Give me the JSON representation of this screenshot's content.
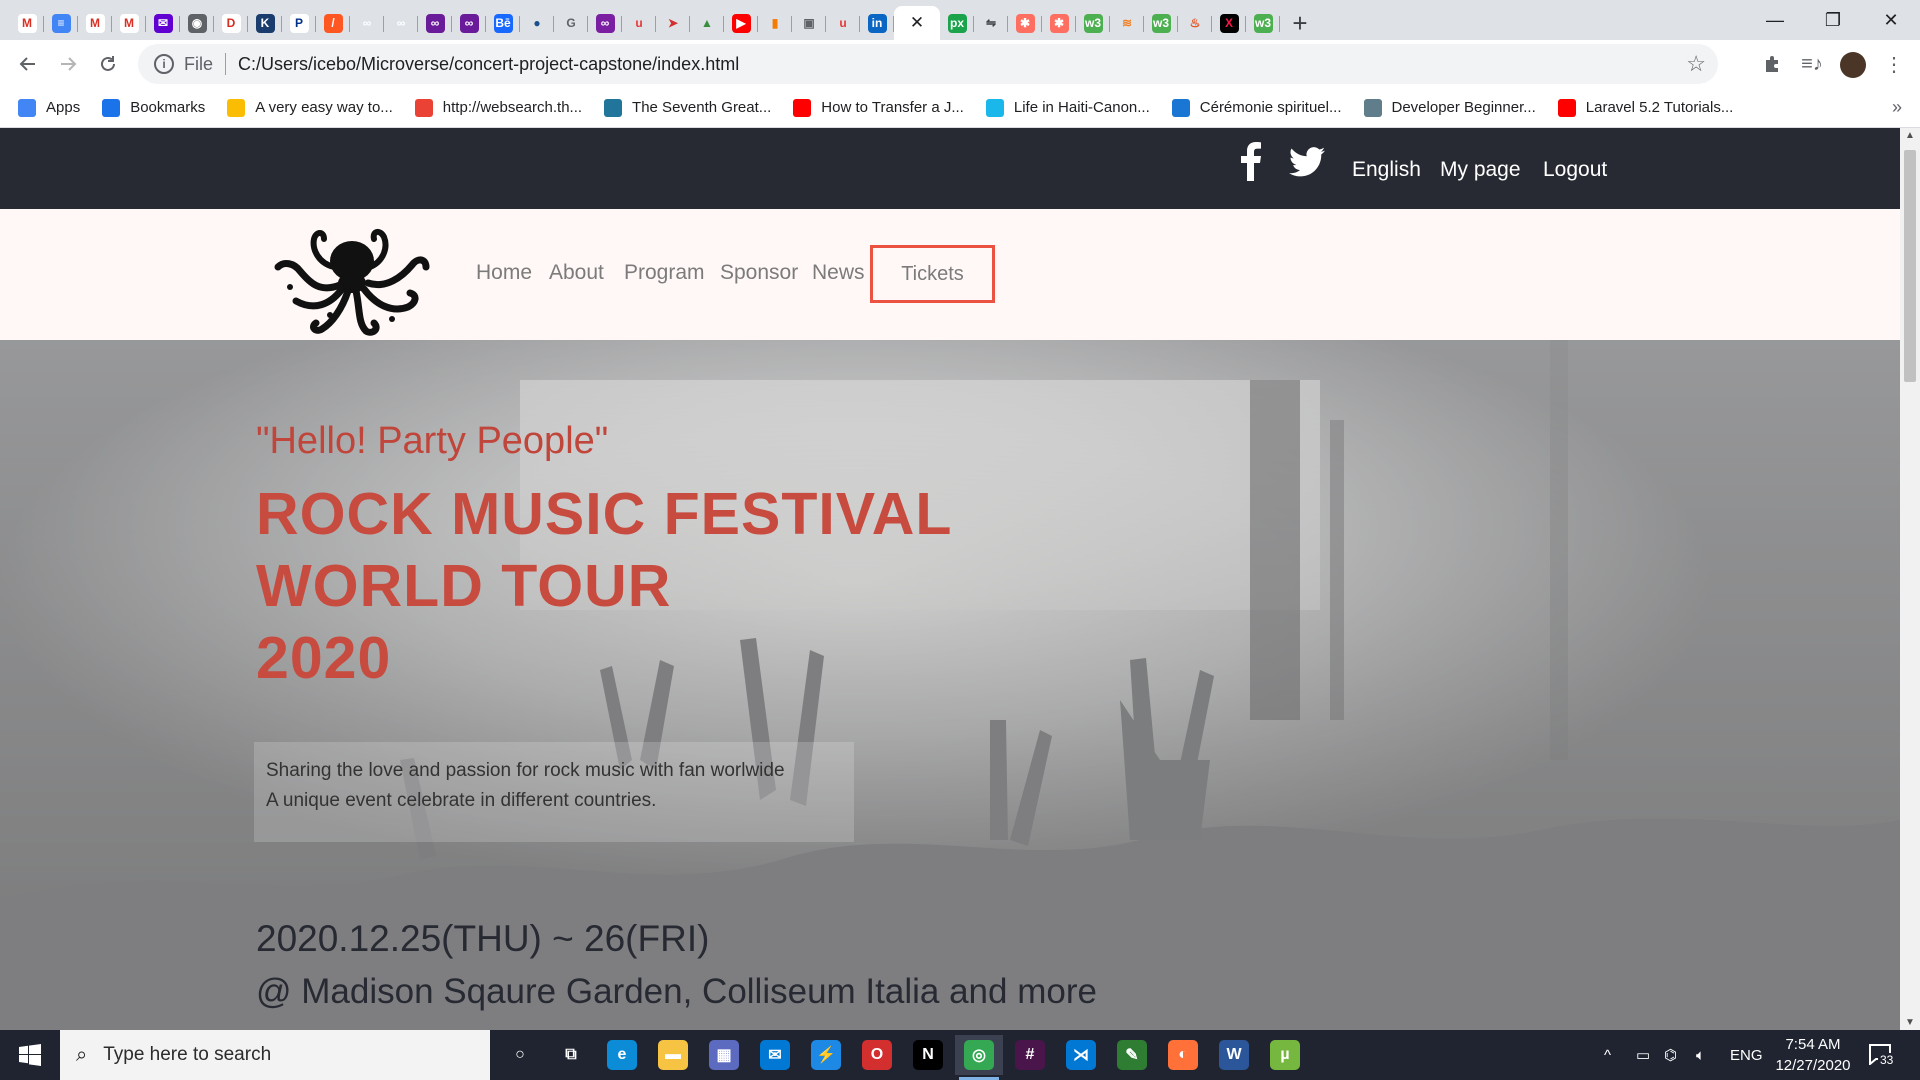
{
  "browser": {
    "tabs": [
      {
        "icon": "gmail-icon",
        "glyph": "M",
        "bg": "#ffffff",
        "fg": "#d93025"
      },
      {
        "icon": "docs-icon",
        "glyph": "≡",
        "bg": "#4285f4",
        "fg": "#ffffff"
      },
      {
        "icon": "gmail-icon",
        "glyph": "M",
        "bg": "#ffffff",
        "fg": "#d93025"
      },
      {
        "icon": "gmail-icon",
        "glyph": "M",
        "bg": "#ffffff",
        "fg": "#d93025"
      },
      {
        "icon": "yahoo-mail-icon",
        "glyph": "✉",
        "bg": "#6001d2",
        "fg": "#ffffff"
      },
      {
        "icon": "globe-icon",
        "glyph": "◉",
        "bg": "#5f6368",
        "fg": "#ffffff"
      },
      {
        "icon": "d-app-icon",
        "glyph": "D",
        "bg": "#ffffff",
        "fg": "#d62d20"
      },
      {
        "icon": "k-app-icon",
        "glyph": "K",
        "bg": "#1a3d6d",
        "fg": "#ffffff"
      },
      {
        "icon": "paypal-icon",
        "glyph": "P",
        "bg": "#ffffff",
        "fg": "#003087"
      },
      {
        "icon": "slash-app-icon",
        "glyph": "/",
        "bg": "#ff5722",
        "fg": "#ffffff"
      },
      {
        "icon": "loop-icon",
        "glyph": "∞",
        "bg": "#dee1e6",
        "fg": "#ffffff"
      },
      {
        "icon": "loop-icon",
        "glyph": "∞",
        "bg": "#dee1e6",
        "fg": "#ffffff"
      },
      {
        "icon": "purple-app-icon",
        "glyph": "∞",
        "bg": "#6a1b9a",
        "fg": "#ffffff"
      },
      {
        "icon": "purple-app-icon",
        "glyph": "∞",
        "bg": "#6a1b9a",
        "fg": "#ffffff"
      },
      {
        "icon": "behance-icon",
        "glyph": "Bē",
        "bg": "#1769ff",
        "fg": "#ffffff"
      },
      {
        "icon": "chat-bubble-icon",
        "glyph": "●",
        "bg": "#dee1e6",
        "fg": "#1a4f8b"
      },
      {
        "icon": "refresh-app-icon",
        "glyph": "G",
        "bg": "#dee1e6",
        "fg": "#5f6368"
      },
      {
        "icon": "purple-app-icon",
        "glyph": "∞",
        "bg": "#7b1fa2",
        "fg": "#ffffff"
      },
      {
        "icon": "u-app-icon",
        "glyph": "u",
        "bg": "#dee1e6",
        "fg": "#e53935"
      },
      {
        "icon": "paper-plane-icon",
        "glyph": "➤",
        "bg": "#dee1e6",
        "fg": "#d32f2f"
      },
      {
        "icon": "map-app-icon",
        "glyph": "▲",
        "bg": "#dee1e6",
        "fg": "#388e3c"
      },
      {
        "icon": "youtube-icon",
        "glyph": "▶",
        "bg": "#ff0000",
        "fg": "#ffffff"
      },
      {
        "icon": "bookmark-app-icon",
        "glyph": "▮",
        "bg": "#dee1e6",
        "fg": "#f57c00"
      },
      {
        "icon": "photo-app-icon",
        "glyph": "▣",
        "bg": "#dee1e6",
        "fg": "#5f6368"
      },
      {
        "icon": "u-app-icon",
        "glyph": "u",
        "bg": "#dee1e6",
        "fg": "#e53935"
      },
      {
        "icon": "linkedin-icon",
        "glyph": "in",
        "bg": "#0a66c2",
        "fg": "#ffffff"
      },
      {
        "icon": "close-tab-icon",
        "glyph": "✕",
        "bg": "#ffffff",
        "fg": "#202124",
        "active": true
      },
      {
        "icon": "px-app-icon",
        "glyph": "px",
        "bg": "#1aa34a",
        "fg": "#ffffff"
      },
      {
        "icon": "arrow-app-icon",
        "glyph": "⇋",
        "bg": "#dee1e6",
        "fg": "#3c4043"
      },
      {
        "icon": "asterisk-app-icon",
        "glyph": "✱",
        "bg": "#ff6f61",
        "fg": "#ffffff"
      },
      {
        "icon": "asterisk-app-icon",
        "glyph": "✱",
        "bg": "#ff6f61",
        "fg": "#ffffff"
      },
      {
        "icon": "w3-icon",
        "glyph": "w3",
        "bg": "#4caf50",
        "fg": "#ffffff"
      },
      {
        "icon": "stack-icon",
        "glyph": "≋",
        "bg": "#dee1e6",
        "fg": "#f48024"
      },
      {
        "icon": "w3-icon",
        "glyph": "w3",
        "bg": "#4caf50",
        "fg": "#ffffff"
      },
      {
        "icon": "flame-icon",
        "glyph": "♨",
        "bg": "#dee1e6",
        "fg": "#e64a19"
      },
      {
        "icon": "x-app-icon",
        "glyph": "X",
        "bg": "#000000",
        "fg": "#ff1744"
      },
      {
        "icon": "w3-icon",
        "glyph": "w3",
        "bg": "#4caf50",
        "fg": "#ffffff"
      }
    ],
    "new_tab": "+",
    "window": {
      "minimize": "—",
      "maximize": "❐",
      "close": "✕"
    },
    "address": {
      "scheme": "File",
      "url": "C:/Users/icebo/Microverse/concert-project-capstone/index.html"
    },
    "bookmarks": [
      {
        "label": "Apps",
        "icon": "apps-grid-icon",
        "color": "#4285f4"
      },
      {
        "label": "Bookmarks",
        "icon": "star-icon",
        "color": "#1a73e8"
      },
      {
        "label": "A very easy way to...",
        "icon": "yandex-icon",
        "color": "#fbbc04"
      },
      {
        "label": "http://websearch.th...",
        "icon": "ring-icon",
        "color": "#ea4335"
      },
      {
        "label": "The Seventh Great...",
        "icon": "wordpress-icon",
        "color": "#21759b"
      },
      {
        "label": "How to Transfer a J...",
        "icon": "youtube-icon",
        "color": "#ff0000"
      },
      {
        "label": "Life in Haiti-Canon...",
        "icon": "vimeo-icon",
        "color": "#1ab7ea"
      },
      {
        "label": "Cérémonie spirituel...",
        "icon": "triangle-icon",
        "color": "#1976d2"
      },
      {
        "label": "Developer Beginner...",
        "icon": "cloud-icon",
        "color": "#607d8b"
      },
      {
        "label": "Laravel 5.2 Tutorials...",
        "icon": "youtube-icon",
        "color": "#ff0000"
      }
    ],
    "more": "»"
  },
  "page": {
    "topbar": {
      "english": "English",
      "mypage": "My page",
      "logout": "Logout"
    },
    "nav": {
      "home": "Home",
      "about": "About",
      "program": "Program",
      "sponsor": "Sponsor",
      "news": "News",
      "tickets": "Tickets"
    },
    "hero": {
      "tagline": "\"Hello! Party People\"",
      "headline": [
        "ROCK MUSIC FESTIVAL",
        "WORLD TOUR",
        "2020"
      ],
      "description": [
        "Sharing the love and passion for rock music with fan worlwide",
        "A unique event celebrate in different countries."
      ],
      "dates": "2020.12.25(THU) ~ 26(FRI)",
      "venue": "@ Madison Sqaure Garden, Colliseum Italia and more"
    },
    "colors": {
      "accent": "#ec5242",
      "dark": "#272a33",
      "headline": "#c74b3f"
    }
  },
  "taskbar": {
    "search_placeholder": "Type here to search",
    "apps": [
      {
        "icon": "cortana-icon",
        "glyph": "○",
        "bg": "transparent"
      },
      {
        "icon": "task-view-icon",
        "glyph": "⧉",
        "bg": "transparent"
      },
      {
        "icon": "edge-icon",
        "glyph": "e",
        "bg": "#0c8bd6"
      },
      {
        "icon": "file-explorer-icon",
        "glyph": "▬",
        "bg": "#f6c343"
      },
      {
        "icon": "store-icon",
        "glyph": "▦",
        "bg": "#5c6bc0"
      },
      {
        "icon": "mail-icon",
        "glyph": "✉",
        "bg": "#0078d4"
      },
      {
        "icon": "messenger-icon",
        "glyph": "⚡",
        "bg": "#1e88e5"
      },
      {
        "icon": "opera-icon",
        "glyph": "O",
        "bg": "#d32f2f"
      },
      {
        "icon": "netflix-icon",
        "glyph": "N",
        "bg": "#000000"
      },
      {
        "icon": "chrome-icon",
        "glyph": "◎",
        "bg": "#34a853"
      },
      {
        "icon": "slack-icon",
        "glyph": "#",
        "bg": "#4a154b"
      },
      {
        "icon": "vscode-icon",
        "glyph": "⋊",
        "bg": "#0078d4"
      },
      {
        "icon": "image-editor-icon",
        "glyph": "✎",
        "bg": "#2e7d32"
      },
      {
        "icon": "firefox-icon",
        "glyph": "◐",
        "bg": "#ff7139"
      },
      {
        "icon": "word-icon",
        "glyph": "W",
        "bg": "#2b579a"
      },
      {
        "icon": "utorrent-icon",
        "glyph": "µ",
        "bg": "#76b83f"
      }
    ],
    "lang": "ENG",
    "time": "7:54 AM",
    "date": "12/27/2020",
    "notifications": "33"
  }
}
